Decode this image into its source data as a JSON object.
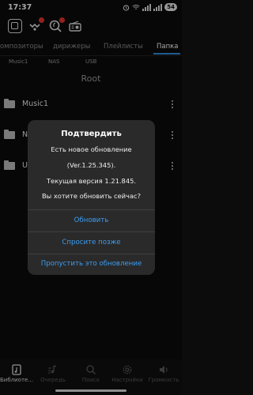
{
  "status_bar": {
    "time": "17:37",
    "battery": "54"
  },
  "top_icons": [
    "home-square-icon",
    "network-icon",
    "search-music-icon",
    "radio-icon"
  ],
  "tabs": [
    {
      "label": "Композиторы",
      "active": false
    },
    {
      "label": "дирижеры",
      "active": false
    },
    {
      "label": "Плейлисты",
      "active": false
    },
    {
      "label": "Папка",
      "active": true
    }
  ],
  "subtabs": [
    "Music1",
    "NAS",
    "USB"
  ],
  "root_title": "Root",
  "folders": [
    {
      "label": "Music1"
    },
    {
      "label": "N"
    },
    {
      "label": "U"
    }
  ],
  "dialog": {
    "title": "Подтвердить",
    "line1": "Есть новое обновление",
    "line2": "(Ver.1.25.345).",
    "line3": "Текущая версия 1.21.845.",
    "line4": "Вы хотите обновить сейчас?",
    "update_button": "Обновить",
    "later_button": "Спросите позже",
    "skip_button": "Пропустить это обновление"
  },
  "bottom_nav": [
    {
      "label": "Библиоте...",
      "icon": "library-icon",
      "active": true
    },
    {
      "label": "Очередь",
      "icon": "queue-icon",
      "active": false
    },
    {
      "label": "Поиск",
      "icon": "search-icon",
      "active": false
    },
    {
      "label": "Настройки",
      "icon": "settings-icon",
      "active": false
    },
    {
      "label": "Громкость",
      "icon": "volume-icon",
      "active": false
    }
  ],
  "colors": {
    "accent": "#3c9cf0",
    "tab_underline": "#2f8fe0",
    "badge": "#e3342f",
    "dialog_bg": "#2a2a2a"
  }
}
